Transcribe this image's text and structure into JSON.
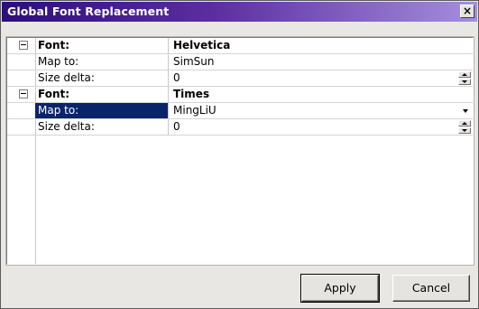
{
  "window": {
    "title": "Global Font Replacement",
    "close_glyph": "×"
  },
  "grid": {
    "rows": [
      {
        "label": "Font:",
        "value": "Helvetica",
        "kind": "header",
        "expander": "minus"
      },
      {
        "label": "Map to:",
        "value": "SimSun",
        "kind": "text"
      },
      {
        "label": "Size delta:",
        "value": "0",
        "kind": "spinner"
      },
      {
        "label": "Font:",
        "value": "Times",
        "kind": "header",
        "expander": "minus"
      },
      {
        "label": "Map to:",
        "value": "MingLiU",
        "kind": "dropdown",
        "selected": true
      },
      {
        "label": "Size delta:",
        "value": "0",
        "kind": "spinner"
      }
    ]
  },
  "buttons": {
    "apply": "Apply",
    "cancel": "Cancel"
  },
  "colors": {
    "selection": "#0a246a",
    "title_gradient_start": "#2c0f79",
    "title_gradient_end": "#a48ee0",
    "dialog_bg": "#e9e7e3"
  },
  "icons": {
    "close": "close-icon",
    "expander": "collapse-minus-icon",
    "spinner": "spin-up-down-icon",
    "dropdown": "chevron-down-icon"
  }
}
